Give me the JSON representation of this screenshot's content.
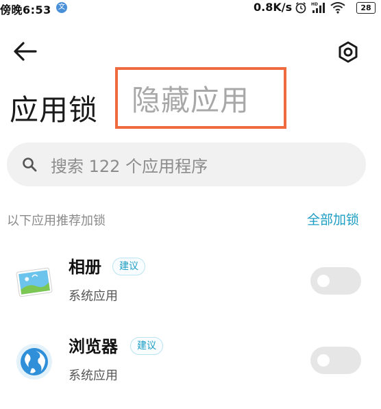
{
  "status": {
    "time": "傍晚6:53",
    "notify_glyph": "文",
    "speed": "0.8K/s",
    "battery": "28"
  },
  "header": {
    "back_icon": "arrow-left-icon",
    "settings_icon": "gear-icon"
  },
  "title_tabs": {
    "active": "应用锁",
    "inactive": "隐藏应用",
    "highlight_color": "#ef6a3f"
  },
  "search": {
    "placeholder": "搜索 122 个应用程序",
    "icon": "search-icon"
  },
  "section": {
    "label": "以下应用推荐加锁",
    "action": "全部加锁",
    "accent_color": "#1c9dc4"
  },
  "apps": [
    {
      "name": "相册",
      "badge": "建议",
      "subtitle": "系统应用",
      "icon": "gallery-icon",
      "locked": false
    },
    {
      "name": "浏览器",
      "badge": "建议",
      "subtitle": "系统应用",
      "icon": "browser-icon",
      "locked": false
    }
  ]
}
